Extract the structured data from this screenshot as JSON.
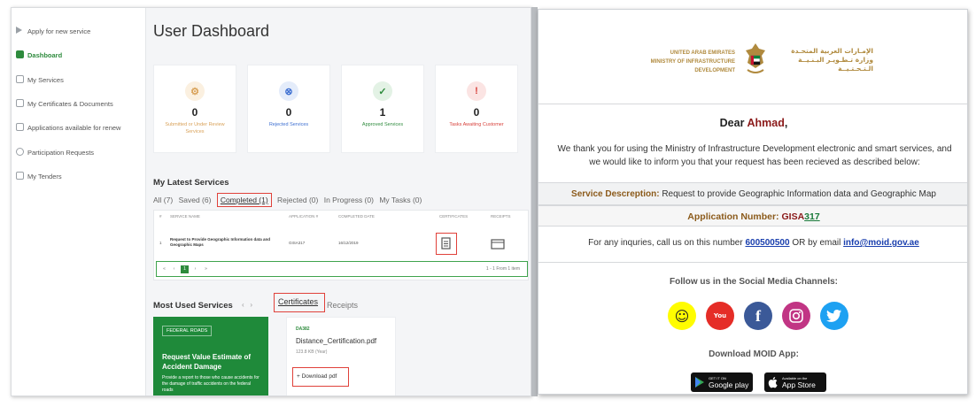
{
  "sidebar": {
    "items": [
      {
        "label": "Apply for new service",
        "icon": "arrow-right-icon"
      },
      {
        "label": "Dashboard",
        "icon": "grid-icon",
        "active": true
      },
      {
        "label": "My Services",
        "icon": "services-icon"
      },
      {
        "label": "My Certificates & Documents",
        "icon": "document-icon"
      },
      {
        "label": "Applications available for renew",
        "icon": "renew-icon"
      },
      {
        "label": "Participation Requests",
        "icon": "clock-icon"
      },
      {
        "label": "My Tenders",
        "icon": "tender-icon"
      }
    ]
  },
  "dashboard": {
    "title": "User Dashboard",
    "cards": [
      {
        "value": "0",
        "label": "Submitted or Under Review Services",
        "color": "#d9a25a",
        "bg": "#fbf0e0",
        "glyph": "⚙"
      },
      {
        "value": "0",
        "label": "Rejected Services",
        "color": "#3d6fd1",
        "bg": "#e4ecfa",
        "glyph": "⊗"
      },
      {
        "value": "1",
        "label": "Approved Services",
        "color": "#2e8b3d",
        "bg": "#e3f2e5",
        "glyph": "✓"
      },
      {
        "value": "0",
        "label": "Tasks Awaiting Customer",
        "color": "#d8433d",
        "bg": "#fbe4e3",
        "glyph": "!"
      }
    ],
    "latest_title": "My Latest Services",
    "tabs": {
      "all": "All (7)",
      "saved": "Saved (6)",
      "completed": "Completed (1)",
      "rejected": "Rejected (0)",
      "progress": "In Progress (0)",
      "tasks": "My Tasks (0)"
    },
    "table": {
      "headers": {
        "num": "#",
        "name": "SERVICE NAME",
        "app": "APPLICATION #",
        "date": "COMPLETED DATE",
        "cert": "CERTIFICATES",
        "rec": "RECEIPTS"
      },
      "row": {
        "num": "1",
        "name": "Request to Provide Geographic Information data and Geographic Maps",
        "app": "GISA317",
        "date": "16/12/2019"
      },
      "pager_text": "1 - 1 From 1 item",
      "page": "1"
    },
    "most_used_title": "Most Used Services",
    "cert_tab": "Certificates",
    "receipts_tab": "Receipts",
    "service_card": {
      "badge": "FEDERAL ROADS",
      "title": "Request Value Estimate of Accident Damage",
      "desc": "Provide a report to those who cause accidents for the damage of traffic accidents on the federal roads"
    },
    "cert_card": {
      "code": "DA382",
      "file": "Distance_Certification.pdf",
      "size": "123.8 KB (Year)",
      "download": "Download pdf"
    }
  },
  "email": {
    "org_en": [
      "UNITED ARAB EMIRATES",
      "MINISTRY OF INFRASTRUCTURE",
      "DEVELOPMENT"
    ],
    "org_ar": [
      "الإمـارات العربية المتحـدة",
      "وزارة تـطـويـر البـنـيــة",
      "الـتـحـتـيــة"
    ],
    "greeting_prefix": "Dear ",
    "name": "Ahmad",
    "greeting_suffix": ",",
    "body": "We thank you for using the Ministry of Infrastructure Development electronic and smart services, and we would like to inform you that your request has been recieved as described below:",
    "service_label": "Service Descreption:",
    "service_value": "Request to provide Geographic Information data and Geographic Map",
    "app_label": "Application Number:",
    "app_prefix": "GISA",
    "app_suffix": "317",
    "contact_prefix": "For any inquries, call us on this number ",
    "phone": "600500500",
    "contact_mid": " OR by email ",
    "email": "info@moid.gov.ae",
    "follow": "Follow us in the Social Media Channels:",
    "download": "Download MOID App:",
    "gp_small": "GET IT ON",
    "gp_big": "Google play",
    "as_small": "Available on the",
    "as_big": "App Store"
  }
}
